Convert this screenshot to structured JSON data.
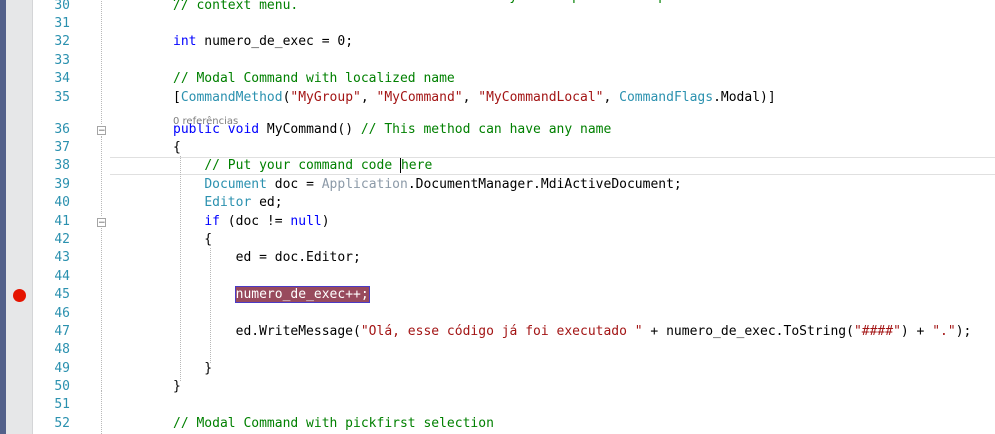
{
  "editor": {
    "code_lens": "0 referências",
    "breakpoint_line": "45",
    "lines": [
      {
        "n": "30",
        "t": [
          [
            "cm",
            "// context menu."
          ]
        ]
      },
      {
        "n": "31",
        "t": []
      },
      {
        "n": "32",
        "t": [
          [
            "kw",
            "int"
          ],
          [
            "pl",
            " numero_de_exec = 0;"
          ]
        ]
      },
      {
        "n": "33",
        "t": []
      },
      {
        "n": "34",
        "t": [
          [
            "cm",
            "// Modal Command with localized name"
          ]
        ]
      },
      {
        "n": "35",
        "t": [
          [
            "pl",
            "["
          ],
          [
            "ty",
            "CommandMethod"
          ],
          [
            "pl",
            "("
          ],
          [
            "st",
            "\"MyGroup\""
          ],
          [
            "pl",
            ", "
          ],
          [
            "st",
            "\"MyCommand\""
          ],
          [
            "pl",
            ", "
          ],
          [
            "st",
            "\"MyCommandLocal\""
          ],
          [
            "pl",
            ", "
          ],
          [
            "ty",
            "CommandFlags"
          ],
          [
            "pl",
            ".Modal)]"
          ]
        ]
      },
      {
        "n": "36",
        "t": [
          [
            "kw",
            "public"
          ],
          [
            "pl",
            " "
          ],
          [
            "kw",
            "void"
          ],
          [
            "pl",
            " MyCommand() "
          ],
          [
            "cm",
            "// This method can have any name"
          ]
        ]
      },
      {
        "n": "37",
        "t": [
          [
            "pl",
            "{"
          ]
        ]
      },
      {
        "n": "38",
        "t": [
          [
            "pl",
            "    "
          ],
          [
            "cm",
            "// Put your command code "
          ],
          [
            "caret",
            ""
          ],
          [
            "cm",
            "here"
          ]
        ]
      },
      {
        "n": "39",
        "t": [
          [
            "pl",
            "    "
          ],
          [
            "ty",
            "Document"
          ],
          [
            "pl",
            " doc = "
          ],
          [
            "gr",
            "Application"
          ],
          [
            "pl",
            ".DocumentManager.MdiActiveDocument;"
          ]
        ]
      },
      {
        "n": "40",
        "t": [
          [
            "pl",
            "    "
          ],
          [
            "ty",
            "Editor"
          ],
          [
            "pl",
            " ed;"
          ]
        ]
      },
      {
        "n": "41",
        "t": [
          [
            "pl",
            "    "
          ],
          [
            "kw",
            "if"
          ],
          [
            "pl",
            " (doc != "
          ],
          [
            "kw",
            "null"
          ],
          [
            "pl",
            ")"
          ]
        ]
      },
      {
        "n": "42",
        "t": [
          [
            "pl",
            "    {"
          ]
        ]
      },
      {
        "n": "43",
        "t": [
          [
            "pl",
            "        ed = doc.Editor;"
          ]
        ]
      },
      {
        "n": "44",
        "t": []
      },
      {
        "n": "45",
        "t": [
          [
            "pl",
            "        "
          ],
          [
            "hl",
            "numero_de_exec++;"
          ]
        ]
      },
      {
        "n": "46",
        "t": []
      },
      {
        "n": "47",
        "t": [
          [
            "pl",
            "        ed.WriteMessage("
          ],
          [
            "st",
            "\"Olá, esse código já foi executado \""
          ],
          [
            "pl",
            " + numero_de_exec.ToString("
          ],
          [
            "st",
            "\"####\""
          ],
          [
            "pl",
            ") + "
          ],
          [
            "st",
            "\".\""
          ],
          [
            "pl",
            ");"
          ]
        ]
      },
      {
        "n": "48",
        "t": []
      },
      {
        "n": "49",
        "t": [
          [
            "pl",
            "    }"
          ]
        ]
      },
      {
        "n": "50",
        "t": [
          [
            "pl",
            "}"
          ]
        ]
      },
      {
        "n": "51",
        "t": []
      },
      {
        "n": "52",
        "t": [
          [
            "cm",
            "// Modal Command with pickfirst selection"
          ]
        ]
      }
    ],
    "top_partial": "// NOTE: CommandMethod has overloads where you can provide helpid and"
  }
}
